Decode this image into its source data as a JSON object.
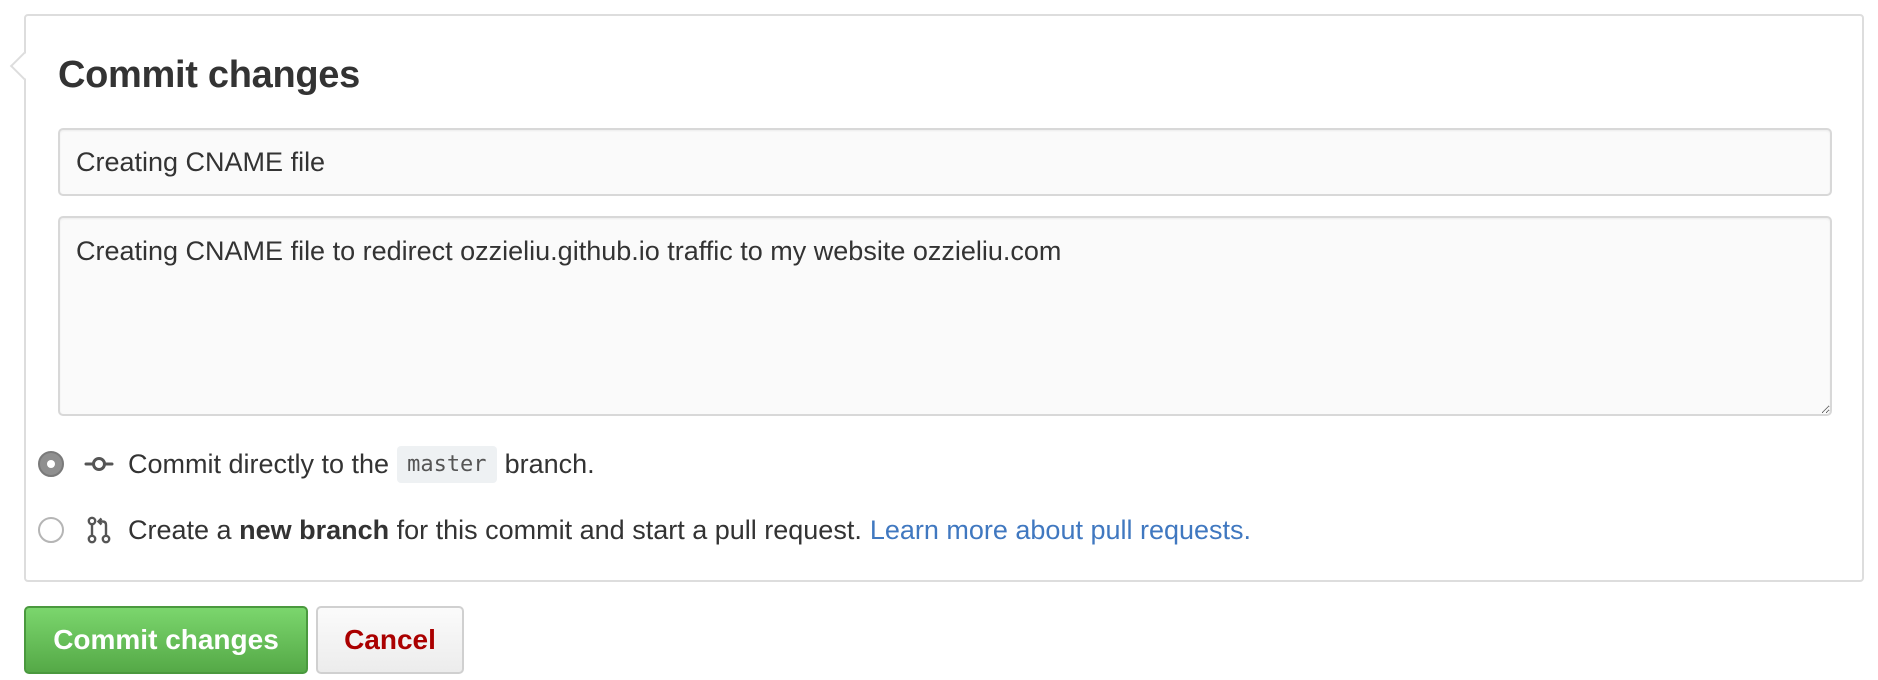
{
  "form": {
    "title": "Commit changes",
    "summary_value": "Creating CNAME file",
    "description_value": "Creating CNAME file to redirect ozzieliu.github.io traffic to my website ozzieliu.com"
  },
  "options": {
    "direct": {
      "text_before": "Commit directly to the",
      "branch_name": "master",
      "text_after": "branch.",
      "selected": true,
      "icon": "git-commit-icon"
    },
    "new_branch": {
      "text_before": "Create a",
      "bold_text": "new branch",
      "text_after": "for this commit and start a pull request.",
      "link_text": "Learn more about pull requests.",
      "selected": false,
      "icon": "git-pull-request-icon"
    }
  },
  "buttons": {
    "commit_label": "Commit changes",
    "cancel_label": "Cancel"
  },
  "colors": {
    "commit_green": "#55a947",
    "cancel_red": "#aa0000",
    "link_blue": "#4078c0"
  }
}
